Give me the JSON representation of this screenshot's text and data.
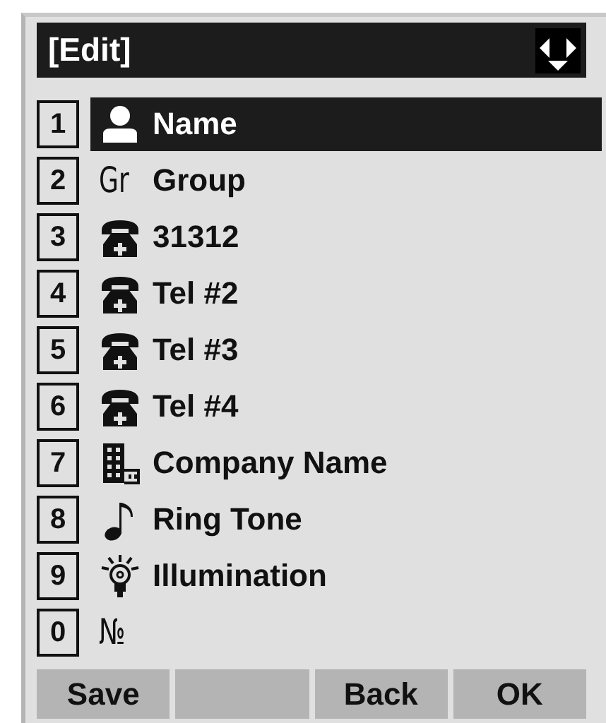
{
  "title": "[Edit]",
  "items": [
    {
      "key": "1",
      "kind": "person",
      "label": "Name",
      "selected": true
    },
    {
      "key": "2",
      "kind": "glyph",
      "icon_text": "Gr",
      "label": "Group",
      "selected": false
    },
    {
      "key": "3",
      "kind": "phone",
      "label": "31312",
      "selected": false
    },
    {
      "key": "4",
      "kind": "phone",
      "label": "Tel #2",
      "selected": false
    },
    {
      "key": "5",
      "kind": "phone",
      "label": "Tel #3",
      "selected": false
    },
    {
      "key": "6",
      "kind": "phone",
      "label": "Tel #4",
      "selected": false
    },
    {
      "key": "7",
      "kind": "building",
      "label": "Company Name",
      "selected": false
    },
    {
      "key": "8",
      "kind": "note",
      "label": "Ring Tone",
      "selected": false
    },
    {
      "key": "9",
      "kind": "bulb",
      "label": "Illumination",
      "selected": false
    },
    {
      "key": "0",
      "kind": "glyph",
      "icon_text": "№",
      "selected": false
    }
  ],
  "softkeys": [
    {
      "kind": "key",
      "label": "Save"
    },
    {
      "kind": "blank"
    },
    {
      "kind": "key",
      "label": "Back"
    },
    {
      "kind": "key",
      "label": "OK"
    }
  ]
}
